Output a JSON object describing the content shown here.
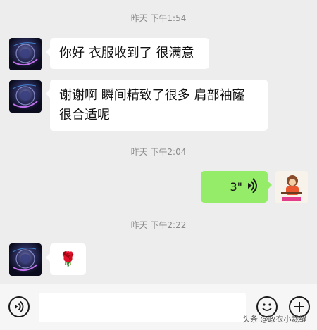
{
  "messages": {
    "time1": "昨天 下午1:54",
    "msg1": "你好 衣服收到了 很满意",
    "msg2_line1": "谢谢啊 瞬间精致了很多 肩部袖窿",
    "msg2_line2": "很合适呢",
    "time2": "昨天 下午2:04",
    "voice_duration": "3\"",
    "time3": "昨天 下午2:22",
    "rose_emoji": "🌹"
  },
  "icons": {
    "voice": "voice-mode-icon",
    "emoji": "emoji-icon",
    "plus": "plus-icon"
  },
  "watermark": "头条 @政衣小裁缝",
  "colors": {
    "background": "#ededed",
    "self_bubble": "#95ec69",
    "other_bubble": "#ffffff"
  }
}
